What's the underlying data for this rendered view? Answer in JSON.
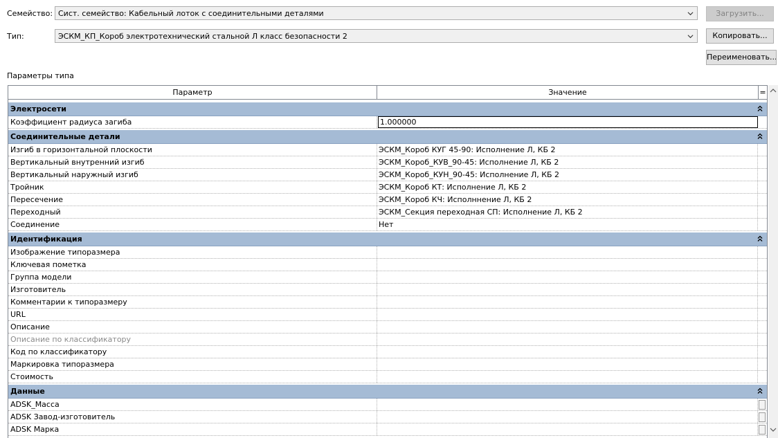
{
  "header": {
    "family_label": "Семейство:",
    "family_value": "Сист. семейство: Кабельный лоток с соединительными деталями",
    "type_label": "Тип:",
    "type_value": "ЭСКМ_КП_Короб электротехнический стальной Л класс безопасности 2",
    "load_button": "Загрузить...",
    "copy_button": "Копировать...",
    "rename_button": "Переименовать...",
    "section_label": "Параметры типа"
  },
  "table": {
    "col_param": "Параметр",
    "col_value": "Значение",
    "col_eq": "=",
    "groups": [
      {
        "title": "Электросети",
        "toggle": "⌃",
        "rows": [
          {
            "param": "Коэффициент радиуса загиба",
            "value": "1.000000"
          }
        ]
      },
      {
        "title": "Соединительные детали",
        "toggle": "⌃",
        "rows": [
          {
            "param": "Изгиб в горизонтальной плоскости",
            "value": "ЭСКМ_Короб КУГ 45-90: Исполнение Л, КБ 2"
          },
          {
            "param": "Вертикальный внутренний изгиб",
            "value": "ЭСКМ_Короб_КУВ_90-45: Исполнение Л, КБ 2"
          },
          {
            "param": "Вертикальный наружный изгиб",
            "value": "ЭСКМ_Короб_КУН_90-45: Исполнение Л, КБ 2"
          },
          {
            "param": "Тройник",
            "value": "ЭСКМ_Короб КТ: Исполнение Л, КБ 2"
          },
          {
            "param": "Пересечение",
            "value": "ЭСКМ_Короб КЧ: Исполннение Л, КБ 2"
          },
          {
            "param": "Переходный",
            "value": "ЭСКМ_Секция переходная СП: Исполнение Л, КБ 2"
          },
          {
            "param": "Соединение",
            "value": "Нет"
          }
        ]
      },
      {
        "title": "Идентификация",
        "toggle": "⌃",
        "rows": [
          {
            "param": "Изображение типоразмера",
            "value": ""
          },
          {
            "param": "Ключевая пометка",
            "value": ""
          },
          {
            "param": "Группа модели",
            "value": ""
          },
          {
            "param": "Изготовитель",
            "value": ""
          },
          {
            "param": "Комментарии к типоразмеру",
            "value": ""
          },
          {
            "param": "URL",
            "value": ""
          },
          {
            "param": "Описание",
            "value": ""
          },
          {
            "param": "Описание по классификатору",
            "value": ""
          },
          {
            "param": "Код по классификатору",
            "value": ""
          },
          {
            "param": "Маркировка типоразмера",
            "value": ""
          },
          {
            "param": "Стоимость",
            "value": ""
          }
        ]
      },
      {
        "title": "Данные",
        "toggle": "⌃",
        "rows": [
          {
            "param": "ADSK_Масса",
            "value": ""
          },
          {
            "param": "ADSK Завод-изготовитель",
            "value": ""
          },
          {
            "param": "ADSK Марка",
            "value": ""
          }
        ]
      }
    ]
  },
  "icons": {
    "combo_arrow": "chevron-down-icon",
    "collapse": "double-chevron-up-icon",
    "scroll_up": "scroll-up-arrow-icon",
    "scroll_down": "scroll-down-arrow-icon"
  },
  "colors": {
    "group_header_bg": "#a5bbd5",
    "button_bg": "#e1e1e1",
    "disabled_text": "#838383"
  }
}
